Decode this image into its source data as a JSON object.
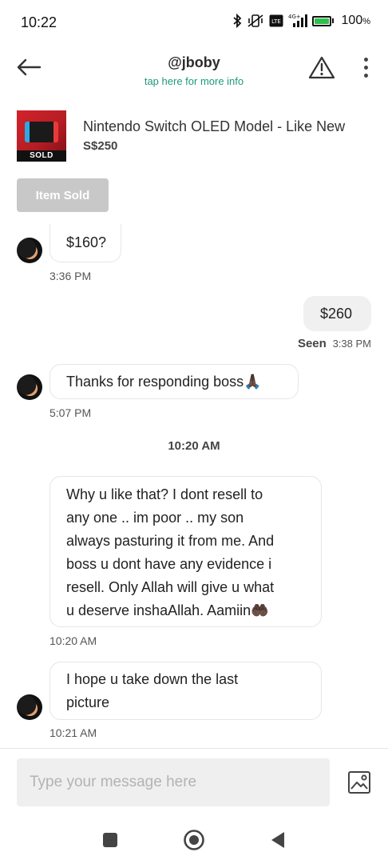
{
  "status_bar": {
    "time": "10:22",
    "battery_percent": "100",
    "battery_unit": "%",
    "network": "4G+",
    "lte": "LTE"
  },
  "header": {
    "username": "@jboby",
    "subtitle": "tap here for more info"
  },
  "listing": {
    "title": "Nintendo Switch OLED Model - Like New",
    "price": "S$250",
    "thumb_badge": "SOLD",
    "status_button": "Item Sold"
  },
  "messages": [
    {
      "side": "in",
      "text": "$160?",
      "time": "3:36 PM"
    },
    {
      "side": "out",
      "text": "$260",
      "seen_label": "Seen",
      "time": "3:38 PM"
    },
    {
      "side": "in",
      "text": "Thanks for responding boss",
      "emoji": "🙏🏿",
      "time": "5:07 PM"
    },
    {
      "side": "in",
      "lines": [
        "Why u like that? I dont resell to",
        "any one .. im poor .. my son",
        "always pasturing it from me.  And",
        "boss u dont have any evidence i",
        "resell. Only Allah will give u what"
      ],
      "last_line": "u deserve inshaAllah. Aamiin",
      "emoji": "🤲🏿",
      "time": "10:20 AM"
    },
    {
      "side": "in",
      "lines": [
        "I hope u take down the last",
        "picture"
      ],
      "time": "10:21 AM"
    }
  ],
  "day_divider": "10:20 AM",
  "composer": {
    "placeholder": "Type your message here"
  },
  "colors": {
    "accent": "#1d9a7a",
    "disabled_button": "#c8c8c8",
    "outgoing_bubble": "#f0f0f0"
  }
}
